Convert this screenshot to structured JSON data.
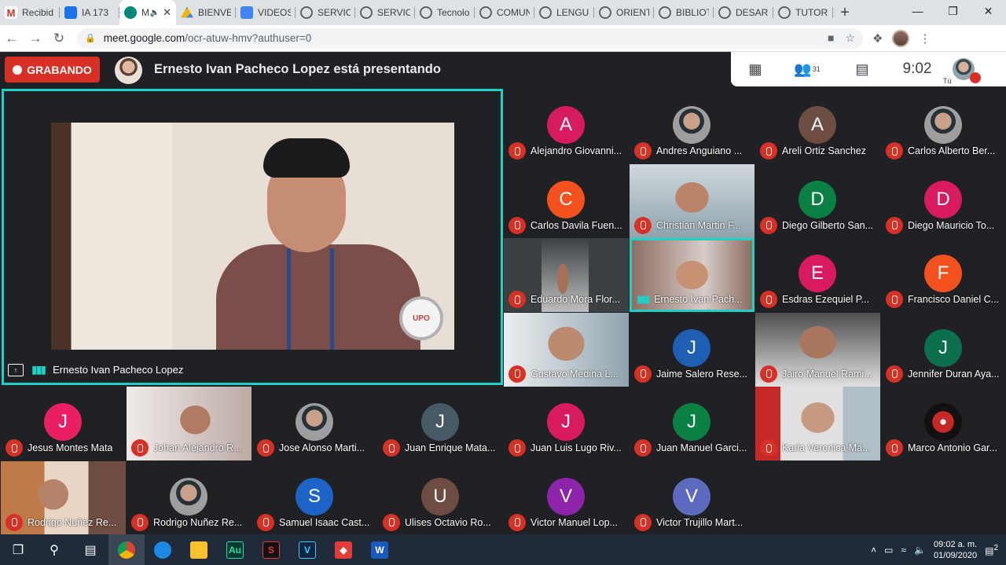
{
  "browser": {
    "tabs": [
      {
        "label": "Recibid",
        "icon": "gmail-icon",
        "fav": "fav-gmail",
        "fav_text": "M"
      },
      {
        "label": "IA 173",
        "icon": "docs-icon",
        "fav": "fav-docs",
        "fav_text": ""
      },
      {
        "label": "M",
        "icon": "meet-icon",
        "fav": "fav-meet",
        "fav_text": "",
        "active": true
      },
      {
        "label": "BIENVE",
        "icon": "drive-icon",
        "fav": "fav-drive",
        "fav_text": ""
      },
      {
        "label": "VIDEOS",
        "icon": "forms-icon",
        "fav": "fav-forms",
        "fav_text": ""
      },
      {
        "label": "SERVICI",
        "icon": "globe-icon",
        "fav": "fav-globe",
        "fav_text": ""
      },
      {
        "label": "SERVICI",
        "icon": "globe-icon",
        "fav": "fav-globe",
        "fav_text": ""
      },
      {
        "label": "Tecnolo",
        "icon": "globe-icon",
        "fav": "fav-globe",
        "fav_text": ""
      },
      {
        "label": "COMUN",
        "icon": "globe-icon",
        "fav": "fav-globe",
        "fav_text": ""
      },
      {
        "label": "LENGU",
        "icon": "globe-icon",
        "fav": "fav-globe",
        "fav_text": ""
      },
      {
        "label": "ORIENT",
        "icon": "globe-icon",
        "fav": "fav-globe",
        "fav_text": ""
      },
      {
        "label": "BIBLIOT",
        "icon": "globe-icon",
        "fav": "fav-globe",
        "fav_text": ""
      },
      {
        "label": "DESARI",
        "icon": "globe-icon",
        "fav": "fav-globe",
        "fav_text": ""
      },
      {
        "label": "TUTORI",
        "icon": "globe-icon",
        "fav": "fav-globe",
        "fav_text": ""
      }
    ],
    "url_host": "meet.google.com",
    "url_path": "/ocr-atuw-hmv?authuser=0"
  },
  "meet": {
    "recording_label": "GRABANDO",
    "presenting_text": "Ernesto Ivan Pacheco Lopez está presentando",
    "participant_count": "31",
    "clock": "9:02",
    "self_label": "Tú",
    "presentation_name": "Ernesto Ivan Pacheco Lopez",
    "presentation_logo_text": "UPO",
    "accent_color": "#1fd1c4",
    "muted_color": "#d93025"
  },
  "participants": [
    {
      "name": "Alejandro Giovanni...",
      "initial": "A",
      "color": "#d81b60"
    },
    {
      "name": "Andres Anguiano ...",
      "photo": true
    },
    {
      "name": "Areli Ortiz Sanchez",
      "initial": "A",
      "color": "#6d4c41"
    },
    {
      "name": "Carlos Alberto Ber...",
      "photo": true
    },
    {
      "name": "Carlos Davila Fuen...",
      "initial": "C",
      "color": "#f4511e"
    },
    {
      "name": "Christian Martin F...",
      "video": "vid-a"
    },
    {
      "name": "Diego Gilberto San...",
      "initial": "D",
      "color": "#0b8043"
    },
    {
      "name": "Diego Mauricio To...",
      "initial": "D",
      "color": "#d81b60"
    },
    {
      "name": "Eduardo Mora Flor...",
      "video": "vid-h",
      "narrow": true
    },
    {
      "name": "Ernesto Ivan Pach...",
      "video": "vid-b",
      "speaking": true
    },
    {
      "name": "Esdras Ezequiel P...",
      "initial": "E",
      "color": "#d81b60"
    },
    {
      "name": "Francisco Daniel C...",
      "initial": "F",
      "color": "#f4511e"
    },
    {
      "name": "Gustavo Medina L...",
      "video": "vid-g"
    },
    {
      "name": "Jaime Salero Rese...",
      "initial": "J",
      "color": "#1e5fb3"
    },
    {
      "name": "Jairo Manuel Rami...",
      "video": "vid-d"
    },
    {
      "name": "Jennifer Duran Aya...",
      "initial": "J",
      "color": "#0b6e4f"
    },
    {
      "name": "Jesus Montes Mata",
      "initial": "J",
      "color": "#e91e63"
    },
    {
      "name": "Johan Alejandro R...",
      "video": "vid-c"
    },
    {
      "name": "Jose Alonso Marti...",
      "photo": true
    },
    {
      "name": "Juan Enrique Mata...",
      "initial": "J",
      "color": "#455a64"
    },
    {
      "name": "Juan Luis Lugo Riv...",
      "initial": "J",
      "color": "#d81b60"
    },
    {
      "name": "Juan Manuel Garci...",
      "initial": "J",
      "color": "#0b8043"
    },
    {
      "name": "Karla Veronica Ma...",
      "video": "vid-e"
    },
    {
      "name": "Marco Antonio Gar...",
      "spider": true
    },
    {
      "name": "Rodrigo Nuñez Re...",
      "video": "vid-f"
    },
    {
      "name": "Rodrigo Nuñez Re...",
      "photo": true
    },
    {
      "name": "Samuel Isaac Cast...",
      "initial": "S",
      "color": "#1e63c7"
    },
    {
      "name": "Ulises Octavio Ro...",
      "initial": "U",
      "color": "#6d4c41"
    },
    {
      "name": "Victor Manuel Lop...",
      "initial": "V",
      "color": "#8e24aa"
    },
    {
      "name": "Victor Trujillo Mart...",
      "initial": "V",
      "color": "#5c6bc0"
    }
  ],
  "taskbar": {
    "time": "09:02 a. m.",
    "date": "01/09/2020",
    "notifications": "2"
  }
}
